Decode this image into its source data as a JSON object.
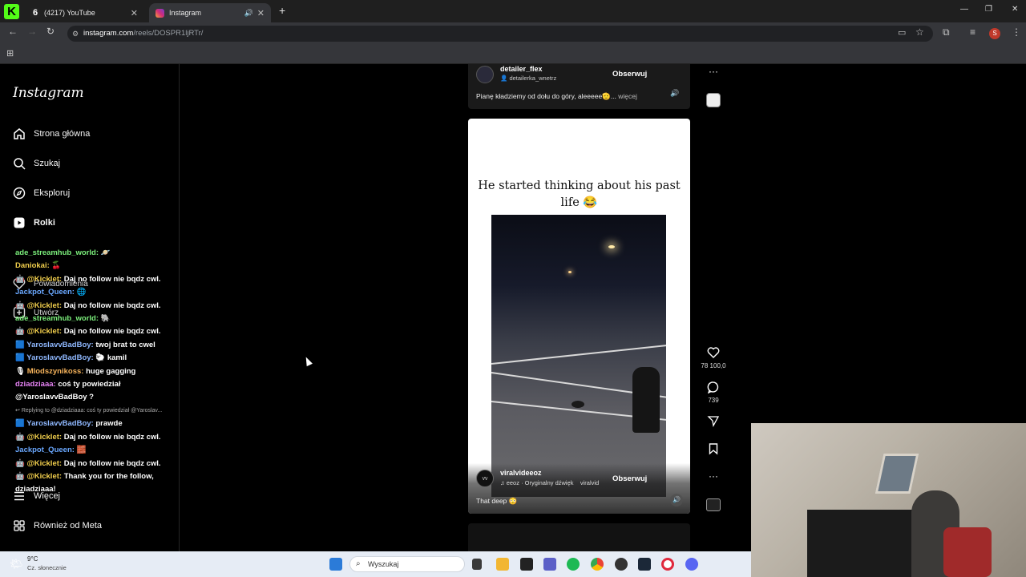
{
  "browser": {
    "tabs": [
      {
        "label": "(4217) YouTube",
        "close": "✕"
      },
      {
        "label": "Instagram",
        "close": "✕"
      }
    ],
    "new_tab": "+",
    "url_domain": "instagram.com",
    "url_path": "/reels/DOSPR1ljRTr/",
    "avatar_letter": "S"
  },
  "sidebar": {
    "logo": "Instagram",
    "items": [
      {
        "label": "Strona główna",
        "icon": "home-icon"
      },
      {
        "label": "Szukaj",
        "icon": "search-icon"
      },
      {
        "label": "Eksploruj",
        "icon": "compass-icon"
      },
      {
        "label": "Rolki",
        "icon": "reels-icon"
      },
      {
        "label": "Powiadomienia",
        "icon": "heart-icon"
      },
      {
        "label": "Utwórz",
        "icon": "plus-icon"
      },
      {
        "label": "Więcej",
        "icon": "menu-icon"
      },
      {
        "label": "Również od Meta",
        "icon": "meta-icon"
      }
    ]
  },
  "chat": [
    {
      "user": "ade_streamhub_world:",
      "text": "",
      "color": "green"
    },
    {
      "user": "Daniokai:",
      "text": "",
      "color": "yellow"
    },
    {
      "user": "@Kicklet:",
      "text": "Daj no follow nie bqdz cwl.",
      "color": "yellow",
      "badges": true
    },
    {
      "user": "Jackpot_Queen:",
      "text": "",
      "color": "blue"
    },
    {
      "user": "@Kicklet:",
      "text": "Daj no follow nie bqdz cwl.",
      "color": "yellow",
      "badges": true
    },
    {
      "user": "ade_streamhub_world:",
      "text": "",
      "color": "green"
    },
    {
      "user": "@Kicklet:",
      "text": "Daj no follow nie bqdz cwl.",
      "color": "yellow",
      "badges": true
    },
    {
      "user": "YaroslavvBadBoy:",
      "text": "twoj brat to cwel",
      "color": "lblue",
      "badges": true
    },
    {
      "user": "YaroslavvBadBoy:",
      "text": "kamil",
      "color": "lblue",
      "badges": true
    },
    {
      "user": "Mlodszynikoss:",
      "text": "huge gagging",
      "color": "orange"
    },
    {
      "user": "dziadziaaa:",
      "text": "coś ty powiedział @YaroslavvBadBoy ?",
      "color": "pink"
    },
    {
      "reply": "Replying to @dziadziaaa: coś ty powiedział @Yaroslav..."
    },
    {
      "user": "YaroslavvBadBoy:",
      "text": "prawde",
      "color": "lblue",
      "badges": true
    },
    {
      "user": "@Kicklet:",
      "text": "Daj no follow nie bqdz cwl.",
      "color": "yellow",
      "badges": true
    },
    {
      "user": "Jackpot_Queen:",
      "text": "",
      "color": "blue"
    },
    {
      "user": "@Kicklet:",
      "text": "Daj no follow nie bqdz cwl.",
      "color": "yellow",
      "badges": true
    },
    {
      "user": "@Kicklet:",
      "text": "Thank you for the follow, dziadziaaa!",
      "color": "yellow",
      "badges": true
    }
  ],
  "reel_top": {
    "username": "detailer_flex",
    "sub": "detailerka_wnetrz",
    "follow": "Obserwuj",
    "caption": "Pianę kładziemy od dołu do góry, aleeeee🫡...",
    "more": "więcej"
  },
  "reel_main": {
    "caption": "He started thinking about his past life 😂",
    "username": "viralvideeoz",
    "audio": "eeoz · Oryginalny dźwięk",
    "audio_tail": "viralvid",
    "follow": "Obserwuj",
    "text": "That deep 😳"
  },
  "actions": {
    "likes": "78 100,0",
    "comments": "739"
  },
  "taskbar": {
    "weather_temp": "9°C",
    "weather_desc": "Cz. słonecznie",
    "search_placeholder": "Wyszukaj"
  }
}
